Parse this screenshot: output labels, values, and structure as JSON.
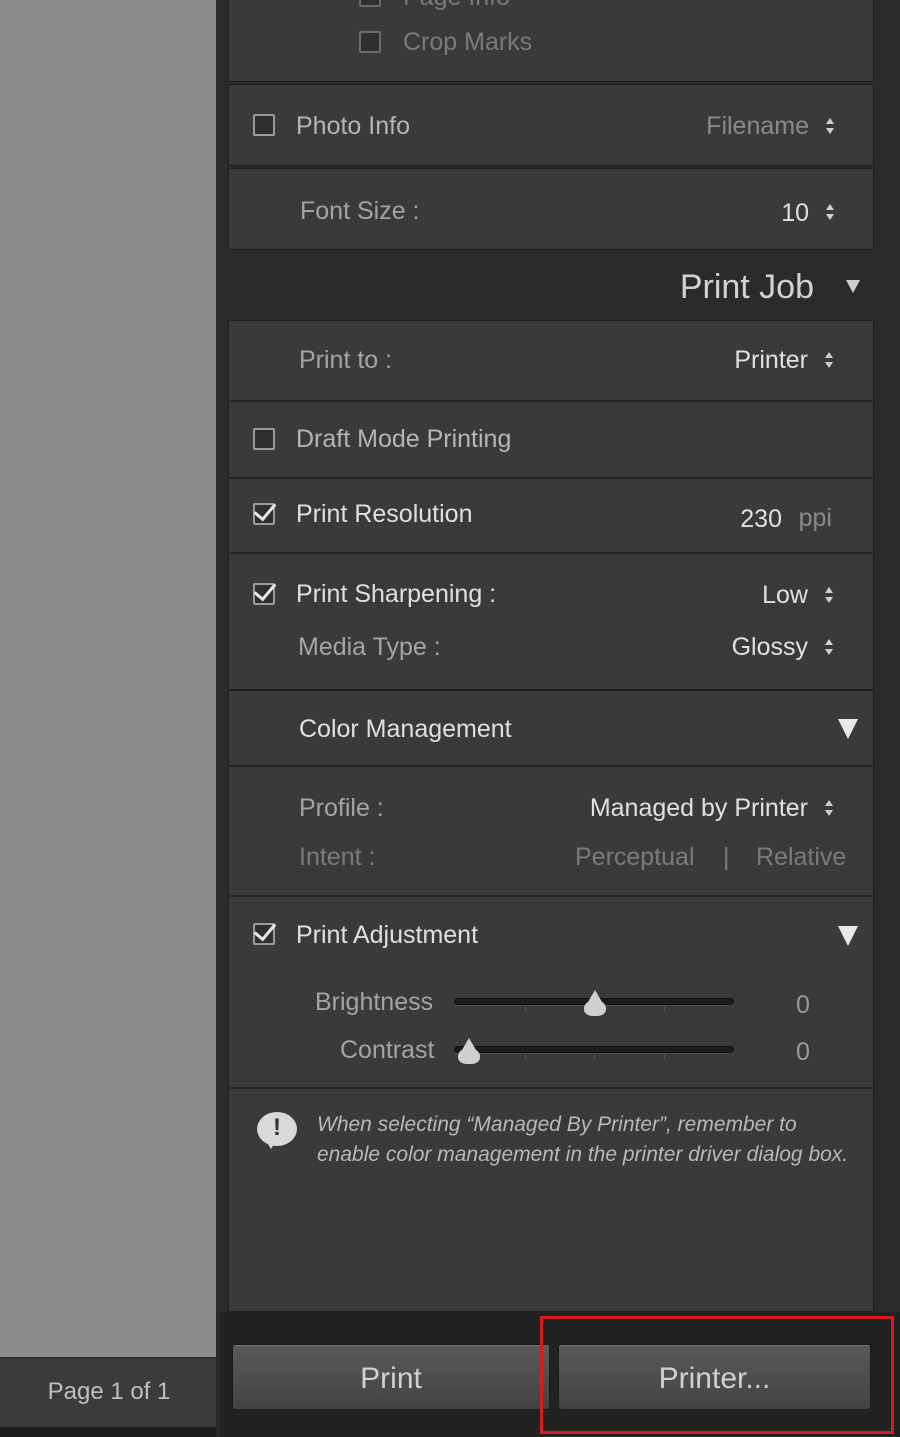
{
  "page_footer": {
    "text": "Page 1 of 1"
  },
  "top_box": {
    "page_info_label": "Page Info",
    "crop_marks_label": "Crop Marks"
  },
  "photo_info": {
    "label": "Photo Info",
    "value": "Filename",
    "checked": false
  },
  "font_size": {
    "label": "Font Size :",
    "value": "10"
  },
  "print_job": {
    "title": "Print Job"
  },
  "print_to": {
    "label": "Print to :",
    "value": "Printer"
  },
  "draft_mode": {
    "label": "Draft Mode Printing",
    "checked": false
  },
  "print_resolution": {
    "label": "Print Resolution",
    "value": "230",
    "unit": "ppi",
    "checked": true
  },
  "print_sharpening": {
    "label": "Print Sharpening :",
    "value": "Low",
    "checked": true
  },
  "media_type": {
    "label": "Media Type :",
    "value": "Glossy"
  },
  "color_management": {
    "title": "Color Management",
    "profile_label": "Profile :",
    "profile_value": "Managed by Printer",
    "intent_label": "Intent :",
    "intent_option_1": "Perceptual",
    "intent_separator": "|",
    "intent_option_2": "Relative"
  },
  "print_adjustment": {
    "title": "Print Adjustment",
    "checked": true,
    "brightness_label": "Brightness",
    "brightness_value": "0",
    "contrast_label": "Contrast",
    "contrast_value": "0"
  },
  "note": {
    "line1": "When selecting “Managed By Printer”, remember to",
    "line2": "enable color management in the printer driver dialog box."
  },
  "buttons": {
    "print_label": "Print",
    "printer_label": "Printer..."
  },
  "colors": {
    "highlight": "#d61c1c",
    "panel_bg": "#3a3a3a",
    "preview_bg": "#8d8d8d"
  }
}
